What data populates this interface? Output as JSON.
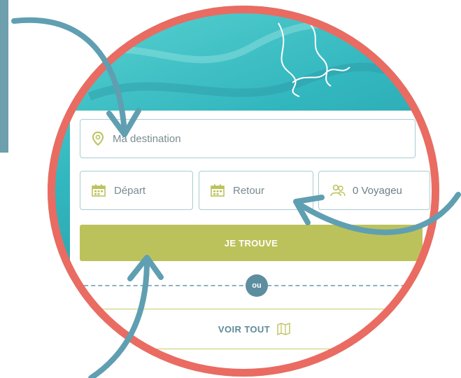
{
  "search": {
    "destination_placeholder": "Ma destination",
    "depart_placeholder": "Départ",
    "retour_placeholder": "Retour",
    "voyageurs_label": "0 Voyageu",
    "submit_label": "JE TROUVE",
    "or_label": "ou",
    "view_all_label": "VOIR TOUT"
  },
  "icons": {
    "destination": "location-pin-icon",
    "depart": "calendar-icon",
    "retour": "calendar-icon",
    "voyageurs": "people-icon",
    "view_all": "map-icon"
  },
  "colors": {
    "ring": "#ea6b61",
    "accent_button": "#bcc25b",
    "annotation_arrow": "#5f9fb1",
    "badge": "#5c8ea0",
    "field_border": "#a9cdd2"
  }
}
